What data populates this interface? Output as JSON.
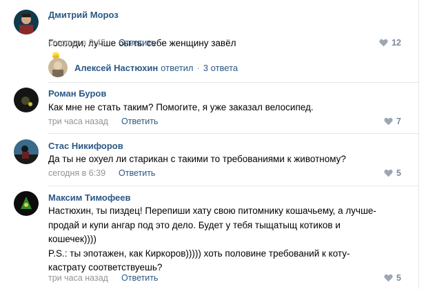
{
  "comments": [
    {
      "author": "Дмитрий Мороз",
      "text": "Господи, лучше бы ты себе женщину завёл",
      "emoji": "👱",
      "date": "сегодня в 3:45",
      "reply_label": "Ответить",
      "likes": "12"
    },
    {
      "author": "Роман Буров",
      "text": "Как мне не стать таким? Помогите, я уже заказал велосипед.",
      "date": "три часа назад",
      "reply_label": "Ответить",
      "likes": "7"
    },
    {
      "author": "Стас Никифоров",
      "text": "Да ты не охуел ли старикан с такими то требованиями к животному?",
      "date": "сегодня в 6:39",
      "reply_label": "Ответить",
      "likes": "5"
    },
    {
      "author": "Максим Тимофеев",
      "text": "Настюхин, ты пиздец! Перепиши хату свою питомнику кошачьему, а лучше-\nпродай и купи ангар под это дело. Будет у тебя тыщатыщ котиков и\nкошечек))))\nP.S.: ты эпотажен, как Киркоров))))) хоть половине требований к коту-\nкастрату соответствуешь?",
      "date": "три часа назад",
      "reply_label": "Ответить",
      "likes": "5"
    }
  ],
  "thread": {
    "name": "Алексей Настюхин",
    "verb": "ответил",
    "separator": "·",
    "count": "3 ответа"
  },
  "colors": {
    "link": "#2a5885",
    "muted": "#939393",
    "like": "#7b8a99",
    "divider": "#e7e8ec"
  },
  "icons": {
    "like": "heart-icon"
  }
}
